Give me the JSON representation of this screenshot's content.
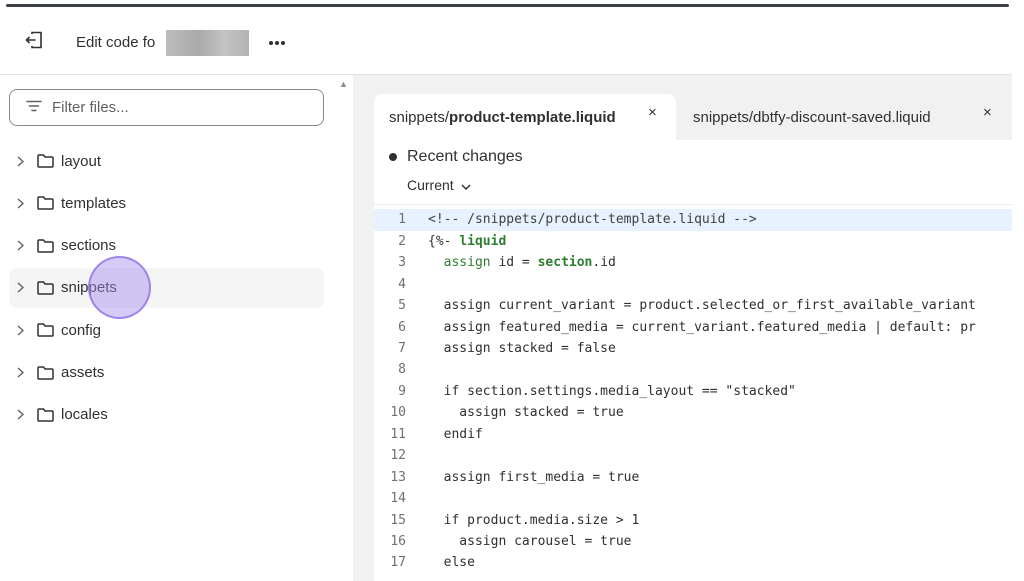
{
  "header": {
    "title": "Edit code fo",
    "exit_icon": "exit-icon",
    "more_icon": "more-horizontal-icon"
  },
  "sidebar": {
    "filter_placeholder": "Filter files...",
    "items": [
      {
        "label": "layout"
      },
      {
        "label": "templates"
      },
      {
        "label": "sections"
      },
      {
        "label": "snippets"
      },
      {
        "label": "config"
      },
      {
        "label": "assets"
      },
      {
        "label": "locales"
      }
    ]
  },
  "tabs": [
    {
      "prefix": "snippets/",
      "name": "product-template.liquid",
      "close": "×"
    },
    {
      "prefix": "snippets/",
      "name": "dbtfy-discount-saved.liquid",
      "close": "×"
    }
  ],
  "editor": {
    "recent_label": "Recent changes",
    "version_label": "Current",
    "lines": [
      {
        "n": "1",
        "text": "<!-- /snippets/product-template.liquid -->"
      },
      {
        "n": "2",
        "text": "{%- liquid"
      },
      {
        "n": "3",
        "text": "  assign id = section.id"
      },
      {
        "n": "4",
        "text": ""
      },
      {
        "n": "5",
        "text": "  assign current_variant = product.selected_or_first_available_variant"
      },
      {
        "n": "6",
        "text": "  assign featured_media = current_variant.featured_media | default: pr"
      },
      {
        "n": "7",
        "text": "  assign stacked = false"
      },
      {
        "n": "8",
        "text": ""
      },
      {
        "n": "9",
        "text": "  if section.settings.media_layout == \"stacked\""
      },
      {
        "n": "10",
        "text": "    assign stacked = true"
      },
      {
        "n": "11",
        "text": "  endif"
      },
      {
        "n": "12",
        "text": ""
      },
      {
        "n": "13",
        "text": "  assign first_media = true"
      },
      {
        "n": "14",
        "text": ""
      },
      {
        "n": "15",
        "text": "  if product.media.size > 1"
      },
      {
        "n": "16",
        "text": "    assign carousel = true"
      },
      {
        "n": "17",
        "text": "  else"
      }
    ]
  },
  "colors": {
    "highlight_line": "#e8f2ff",
    "cursor_ring": "#a48cee",
    "keyword": "#2e7d32"
  }
}
